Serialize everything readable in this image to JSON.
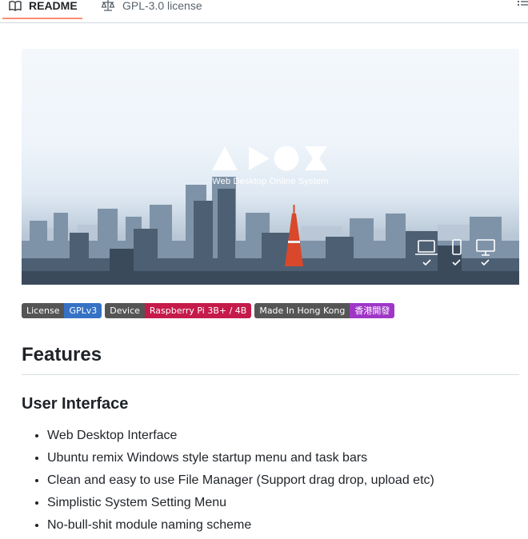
{
  "tabs": {
    "readme": "README",
    "license": "GPL-3.0 license"
  },
  "hero": {
    "logo_text": "AROZ",
    "tagline": "Web Desktop Online System",
    "device_icons": [
      "laptop-icon",
      "phone-icon",
      "desktop-icon"
    ]
  },
  "badges": [
    {
      "label": "License",
      "value": "GPLv3",
      "color": "#3572c5"
    },
    {
      "label": "Device",
      "value": "Raspberry Pi 3B+ / 4B",
      "color": "#c51a4a"
    },
    {
      "label": "Made In Hong Kong",
      "value": "香港開發",
      "color": "#9f36c7"
    }
  ],
  "content": {
    "features_heading": "Features",
    "user_interface_heading": "User Interface",
    "items": [
      "Web Desktop Interface",
      "Ubuntu remix Windows style startup menu and task bars",
      "Clean and easy to use File Manager (Support drag drop, upload etc)",
      "Simplistic System Setting Menu",
      "No-bull-shit module naming scheme"
    ]
  },
  "colors": {
    "active_tab_underline": "#fd8c73",
    "text": "#1f2328",
    "muted": "#59636e"
  }
}
